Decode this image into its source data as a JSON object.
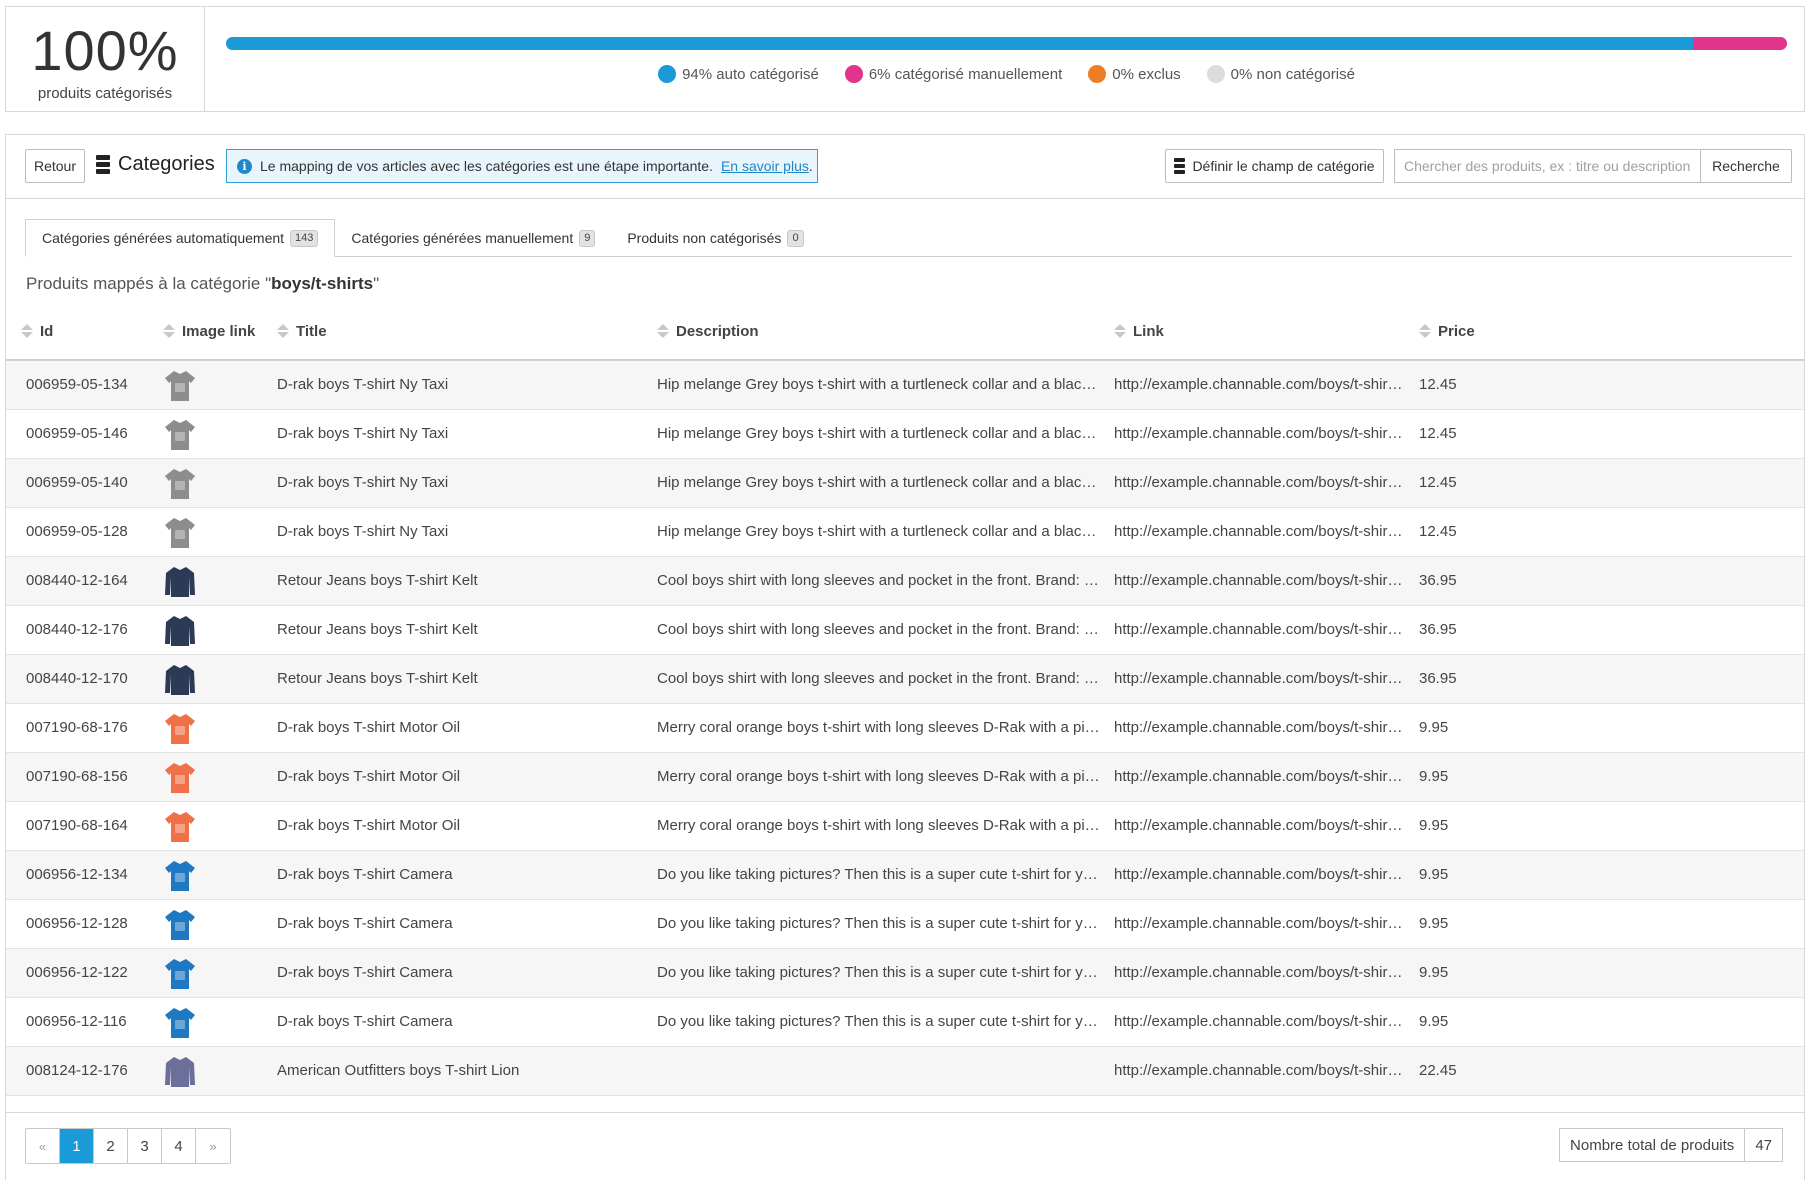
{
  "summary": {
    "percent": "100%",
    "percent_label": "produits catégorisés",
    "segments": [
      {
        "name": "auto",
        "fraction": 0.94,
        "color": "#1a9ad6",
        "label": "94% auto catégorisé"
      },
      {
        "name": "manual",
        "fraction": 0.06,
        "color": "#e0358a",
        "label": "6% catégorisé manuellement"
      },
      {
        "name": "excluded",
        "fraction": 0.0,
        "color": "#ee7d23",
        "label": "0% exclus"
      },
      {
        "name": "uncategorized",
        "fraction": 0.0,
        "color": "#dcdcdc",
        "label": "0% non catégorisé"
      }
    ]
  },
  "toolbar": {
    "back_label": "Retour",
    "title": "Categories",
    "info_text": "Le mapping de vos articles avec les catégories est une étape importante.",
    "info_link": "En savoir plus",
    "info_period": ".",
    "define_label": "Définir le champ de catégorie",
    "search_placeholder": "Chercher des produits, ex : titre ou description",
    "search_label": "Recherche"
  },
  "tabs": [
    {
      "label": "Catégories générées automatiquement",
      "count": "143",
      "active": true
    },
    {
      "label": "Catégories générées manuellement",
      "count": "9",
      "active": false
    },
    {
      "label": "Produits non catégorisés",
      "count": "0",
      "active": false
    }
  ],
  "mapped": {
    "prefix": "Produits mappés à la catégorie \"",
    "category": "boys/t-shirts",
    "suffix": "\""
  },
  "table": {
    "columns": [
      "Id",
      "Image link",
      "Title",
      "Description",
      "Link",
      "Price"
    ],
    "rows": [
      {
        "id": "006959-05-134",
        "image": "grey-tshirt",
        "title": "D-rak boys T-shirt Ny Taxi",
        "description": "Hip melange Grey boys t-shirt with a turtleneck collar and a black cord of th...",
        "link": "http://example.channable.com/boys/t-shirts-shor...",
        "price": "12.45"
      },
      {
        "id": "006959-05-146",
        "image": "grey-tshirt",
        "title": "D-rak boys T-shirt Ny Taxi",
        "description": "Hip melange Grey boys t-shirt with a turtleneck collar and a black cord of th...",
        "link": "http://example.channable.com/boys/t-shirts-shor...",
        "price": "12.45"
      },
      {
        "id": "006959-05-140",
        "image": "grey-tshirt",
        "title": "D-rak boys T-shirt Ny Taxi",
        "description": "Hip melange Grey boys t-shirt with a turtleneck collar and a black cord of th...",
        "link": "http://example.channable.com/boys/t-shirts-shor...",
        "price": "12.45"
      },
      {
        "id": "006959-05-128",
        "image": "grey-tshirt",
        "title": "D-rak boys T-shirt Ny Taxi",
        "description": "Hip melange Grey boys t-shirt with a turtleneck collar and a black cord of th...",
        "link": "http://example.channable.com/boys/t-shirts-shor...",
        "price": "12.45"
      },
      {
        "id": "008440-12-164",
        "image": "navy-longsleeve",
        "title": "Retour Jeans boys T-shirt Kelt",
        "description": "Cool boys shirt with long sleeves and pocket in the front. Brand: Retour Jea...",
        "link": "http://example.channable.com/boys/t-shirts-long...",
        "price": "36.95"
      },
      {
        "id": "008440-12-176",
        "image": "navy-longsleeve",
        "title": "Retour Jeans boys T-shirt Kelt",
        "description": "Cool boys shirt with long sleeves and pocket in the front. Brand: Retour Jea...",
        "link": "http://example.channable.com/boys/t-shirts-long...",
        "price": "36.95"
      },
      {
        "id": "008440-12-170",
        "image": "navy-longsleeve",
        "title": "Retour Jeans boys T-shirt Kelt",
        "description": "Cool boys shirt with long sleeves and pocket in the front. Brand: Retour Jea...",
        "link": "http://example.channable.com/boys/t-shirts-long...",
        "price": "36.95"
      },
      {
        "id": "007190-68-176",
        "image": "coral-tshirt",
        "title": "D-rak boys T-shirt Motor Oil",
        "description": "Merry coral orange boys t-shirt with long sleeves D-Rak with a picture of an ...",
        "link": "http://example.channable.com/boys/t-shirts-long...",
        "price": "9.95"
      },
      {
        "id": "007190-68-156",
        "image": "coral-tshirt",
        "title": "D-rak boys T-shirt Motor Oil",
        "description": "Merry coral orange boys t-shirt with long sleeves D-Rak with a picture of an ...",
        "link": "http://example.channable.com/boys/t-shirts-long...",
        "price": "9.95"
      },
      {
        "id": "007190-68-164",
        "image": "coral-tshirt",
        "title": "D-rak boys T-shirt Motor Oil",
        "description": "Merry coral orange boys t-shirt with long sleeves D-Rak with a picture of an ...",
        "link": "http://example.channable.com/boys/t-shirts-long...",
        "price": "9.95"
      },
      {
        "id": "006956-12-134",
        "image": "blue-tshirt",
        "title": "D-rak boys T-shirt Camera",
        "description": "Do you like taking pictures? Then this is a super cute t-shirt for you! On the f...",
        "link": "http://example.channable.com/boys/t-shirts-shor...",
        "price": "9.95"
      },
      {
        "id": "006956-12-128",
        "image": "blue-tshirt",
        "title": "D-rak boys T-shirt Camera",
        "description": "Do you like taking pictures? Then this is a super cute t-shirt for you! On the f...",
        "link": "http://example.channable.com/boys/t-shirts-shor...",
        "price": "9.95"
      },
      {
        "id": "006956-12-122",
        "image": "blue-tshirt",
        "title": "D-rak boys T-shirt Camera",
        "description": "Do you like taking pictures? Then this is a super cute t-shirt for you! On the f...",
        "link": "http://example.channable.com/boys/t-shirts-shor...",
        "price": "9.95"
      },
      {
        "id": "006956-12-116",
        "image": "blue-tshirt",
        "title": "D-rak boys T-shirt Camera",
        "description": "Do you like taking pictures? Then this is a super cute t-shirt for you! On the f...",
        "link": "http://example.channable.com/boys/t-shirts-shor...",
        "price": "9.95"
      },
      {
        "id": "008124-12-176",
        "image": "lavender-longsleeve",
        "title": "American Outfitters boys T-shirt Lion",
        "description": "",
        "link": "http://example.channable.com/boys/t-shirts-long...",
        "price": "22.45"
      }
    ]
  },
  "pagination": {
    "prev": "«",
    "pages": [
      "1",
      "2",
      "3",
      "4"
    ],
    "current": "1",
    "next": "»",
    "total_label": "Nombre total de produits",
    "total_value": "47"
  },
  "thumb_colors": {
    "grey-tshirt": "#8d8d8d",
    "navy-longsleeve": "#2c3a55",
    "coral-tshirt": "#f07048",
    "blue-tshirt": "#1f78c2",
    "lavender-longsleeve": "#6c6f9a"
  }
}
